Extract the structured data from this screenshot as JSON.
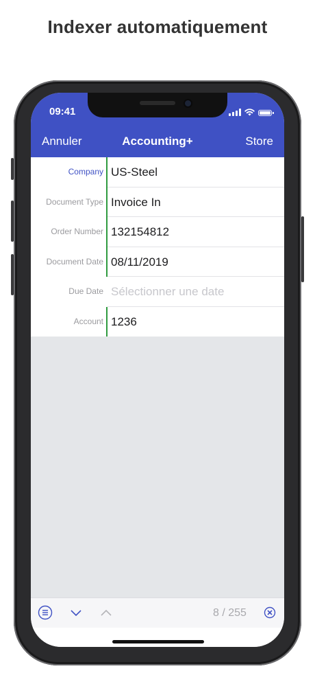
{
  "headline": "Indexer automatiquement",
  "status_bar": {
    "time": "09:41"
  },
  "navbar": {
    "left_button": "Annuler",
    "title": "Accounting+",
    "right_button": "Store"
  },
  "form": {
    "fields": [
      {
        "label": "Company",
        "value": "US-Steel"
      },
      {
        "label": "Document Type",
        "value": "Invoice In"
      },
      {
        "label": "Order Number",
        "value": "132154812"
      },
      {
        "label": "Document Date",
        "value": "08/11/2019"
      },
      {
        "label": "Due Date",
        "placeholder": "Sélectionner une date"
      },
      {
        "label": "Account",
        "value": "1236"
      }
    ]
  },
  "toolbar": {
    "page_counter": "8 / 255",
    "icons": [
      "menu-circle-icon",
      "chevron-down-icon",
      "chevron-up-icon",
      "close-circle-icon"
    ]
  },
  "colors": {
    "accent": "#3f51c4",
    "field_indicator": "#2e9a3e",
    "background": "#e4e6e9"
  }
}
